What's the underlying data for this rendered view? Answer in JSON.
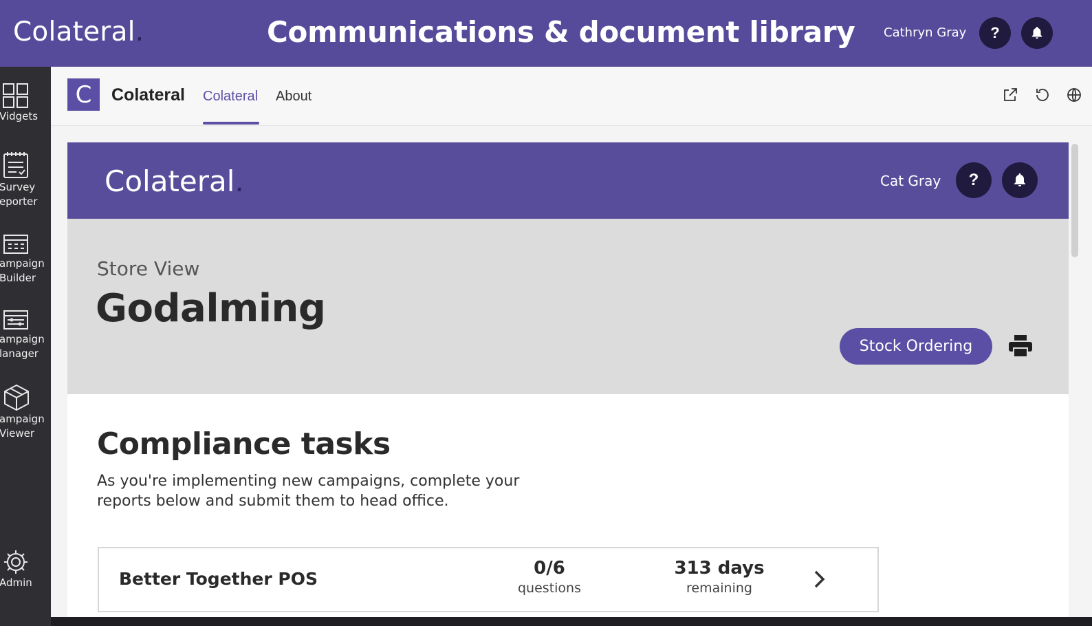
{
  "topbar": {
    "brand": "Colateral",
    "brand_dot": ".",
    "heading": "Communications & document library",
    "user_name": "Cathryn Gray",
    "help_label": "?",
    "colors": {
      "background": "#564b9a",
      "button": "#201a3f"
    }
  },
  "rail": {
    "items": [
      {
        "label": "Vidgets",
        "icon": "widgets-grid-icon"
      },
      {
        "label": "Survey\neporter",
        "icon": "survey-clipboard-icon"
      },
      {
        "label": "ampaign\nBuilder",
        "icon": "campaign-builder-icon"
      },
      {
        "label": "ampaign\nlanager",
        "icon": "campaign-manager-icon"
      },
      {
        "label": "ampaign\nViewer",
        "icon": "campaign-viewer-cube-icon"
      },
      {
        "label": "Admin",
        "icon": "gear-icon"
      }
    ]
  },
  "app_header": {
    "logo_letter": "C",
    "app_name": "Colateral",
    "tabs": [
      {
        "label": "Colateral",
        "active": true
      },
      {
        "label": "About",
        "active": false
      }
    ],
    "icons": [
      "open-external-icon",
      "refresh-icon",
      "globe-icon"
    ]
  },
  "inner": {
    "brand": "Colateral",
    "brand_dot": ".",
    "user_name": "Cat Gray",
    "help_label": "?",
    "store_label": "Store View",
    "store_name": "Godalming",
    "stock_button": "Stock Ordering",
    "compliance_title": "Compliance tasks",
    "compliance_desc": "As you're implementing new campaigns, complete your reports below and submit them to head office.",
    "tasks": [
      {
        "name": "Better Together POS",
        "questions_value": "0/6",
        "questions_label": "questions",
        "days_value": "313 days",
        "days_label": "remaining"
      }
    ],
    "colors": {
      "accent": "#5a4fa5",
      "store_bg": "#dcdcdc"
    }
  }
}
